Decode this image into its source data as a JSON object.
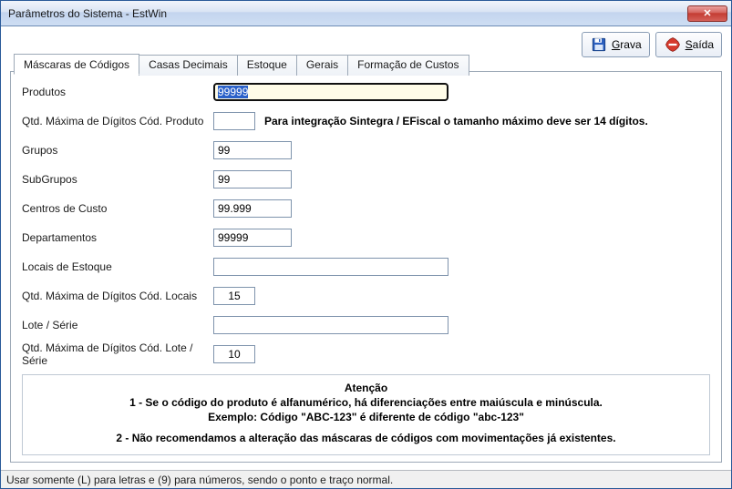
{
  "window": {
    "title": "Parâmetros do Sistema - EstWin"
  },
  "buttons": {
    "save_label_u": "G",
    "save_label": "rava",
    "exit_label_u": "S",
    "exit_label": "aída"
  },
  "tabs": [
    {
      "label": "Máscaras de Códigos",
      "active": true
    },
    {
      "label": "Casas Decimais",
      "active": false
    },
    {
      "label": "Estoque",
      "active": false
    },
    {
      "label": "Gerais",
      "active": false
    },
    {
      "label": "Formação de Custos",
      "active": false
    }
  ],
  "fields": {
    "produtos": {
      "label": "Produtos",
      "value": "99999"
    },
    "qtd_max_produto": {
      "label": "Qtd. Máxima de Dígitos Cód. Produto",
      "value": "",
      "hint": "Para integração Sintegra / EFiscal o tamanho máximo deve ser 14 dígitos."
    },
    "grupos": {
      "label": "Grupos",
      "value": "99"
    },
    "subgrupos": {
      "label": "SubGrupos",
      "value": "99"
    },
    "centros_custo": {
      "label": "Centros de Custo",
      "value": "99.999"
    },
    "departamentos": {
      "label": "Departamentos",
      "value": "99999"
    },
    "locais_estoque": {
      "label": "Locais de Estoque",
      "value": ""
    },
    "qtd_max_locais": {
      "label": "Qtd. Máxima de Dígitos Cód. Locais",
      "value": "15"
    },
    "lote_serie": {
      "label": "Lote / Série",
      "value": ""
    },
    "qtd_max_lote": {
      "label": "Qtd. Máxima de Dígitos Cód. Lote / Série",
      "value": "10"
    }
  },
  "attention": {
    "title": "Atenção",
    "line1": "1 - Se o código do produto é alfanumérico,  há diferenciações entre maiúscula e minúscula.",
    "line2": "Exemplo: Código \"ABC-123\"   é diferente de código   \"abc-123\"",
    "line3": "2 - Não recomendamos a alteração das máscaras de códigos com movimentações já existentes."
  },
  "statusbar": {
    "text": "Usar somente (L) para letras e (9) para números, sendo o ponto e traço normal."
  }
}
